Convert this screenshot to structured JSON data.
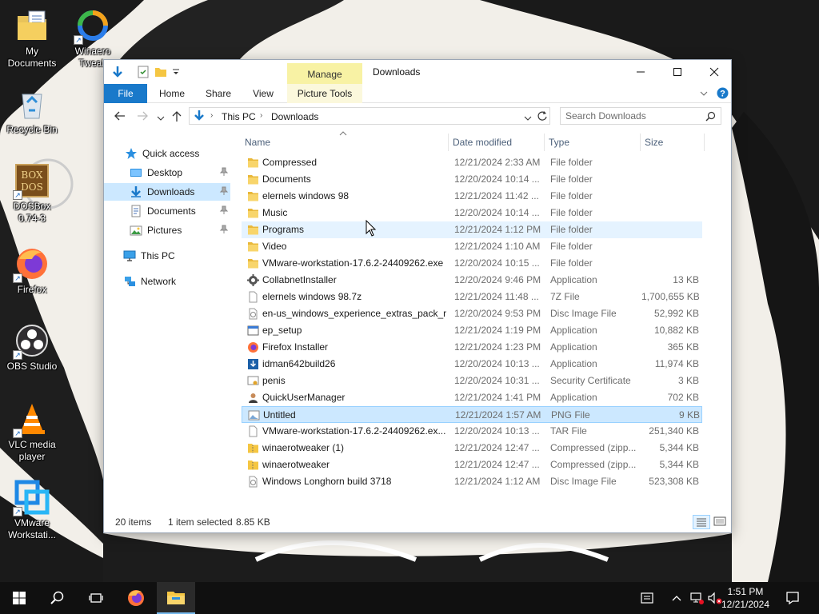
{
  "desktop": {
    "icons": [
      {
        "label": "My Documents",
        "icon": "my-documents-icon"
      },
      {
        "label": "Winaero Tweak",
        "icon": "winaero-tweaker-icon"
      },
      {
        "label": "Recycle Bin",
        "icon": "recycle-bin-icon"
      },
      {
        "label": "DOSBox 0.74-3",
        "icon": "dosbox-icon"
      },
      {
        "label": "Firefox",
        "icon": "firefox-icon"
      },
      {
        "label": "OBS Studio",
        "icon": "obs-icon"
      },
      {
        "label": "VLC media player",
        "icon": "vlc-icon"
      },
      {
        "label": "VMware Workstati...",
        "icon": "vmware-icon"
      }
    ]
  },
  "window": {
    "title": "Downloads",
    "manage_tab": "Manage",
    "ribbon_tabs": [
      "File",
      "Home",
      "Share",
      "View",
      "Picture Tools"
    ],
    "breadcrumb": [
      "This PC",
      "Downloads"
    ],
    "search_placeholder": "Search Downloads",
    "nav": [
      {
        "label": "Quick access",
        "icon": "star-icon",
        "pinned": false
      },
      {
        "label": "Desktop",
        "icon": "desktop-folder-icon",
        "pinned": true
      },
      {
        "label": "Downloads",
        "icon": "downloads-folder-icon",
        "pinned": true
      },
      {
        "label": "Documents",
        "icon": "documents-folder-icon",
        "pinned": true
      },
      {
        "label": "Pictures",
        "icon": "pictures-folder-icon",
        "pinned": true
      },
      {
        "label": "This PC",
        "icon": "computer-icon",
        "pinned": false
      },
      {
        "label": "Network",
        "icon": "network-icon",
        "pinned": false
      }
    ],
    "columns": [
      "Name",
      "Date modified",
      "Type",
      "Size"
    ],
    "files": [
      {
        "name": "Compressed",
        "date": "12/21/2024 2:33 AM",
        "type": "File folder",
        "size": "",
        "icon": "folder"
      },
      {
        "name": "Documents",
        "date": "12/20/2024 10:14 ...",
        "type": "File folder",
        "size": "",
        "icon": "folder"
      },
      {
        "name": "elernels windows 98",
        "date": "12/21/2024 11:42 ...",
        "type": "File folder",
        "size": "",
        "icon": "folder"
      },
      {
        "name": "Music",
        "date": "12/20/2024 10:14 ...",
        "type": "File folder",
        "size": "",
        "icon": "folder"
      },
      {
        "name": "Programs",
        "date": "12/21/2024 1:12 PM",
        "type": "File folder",
        "size": "",
        "icon": "folder"
      },
      {
        "name": "Video",
        "date": "12/21/2024 1:10 AM",
        "type": "File folder",
        "size": "",
        "icon": "folder"
      },
      {
        "name": "VMware-workstation-17.6.2-24409262.exe",
        "date": "12/20/2024 10:15 ...",
        "type": "File folder",
        "size": "",
        "icon": "folder"
      },
      {
        "name": "CollabnetInstaller",
        "date": "12/20/2024 9:46 PM",
        "type": "Application",
        "size": "13 KB",
        "icon": "gear"
      },
      {
        "name": "elernels windows 98.7z",
        "date": "12/21/2024 11:48 ...",
        "type": "7Z File",
        "size": "1,700,655 KB",
        "icon": "file"
      },
      {
        "name": "en-us_windows_experience_extras_pack_r...",
        "date": "12/20/2024 9:53 PM",
        "type": "Disc Image File",
        "size": "52,992 KB",
        "icon": "disc"
      },
      {
        "name": "ep_setup",
        "date": "12/21/2024 1:19 PM",
        "type": "Application",
        "size": "10,882 KB",
        "icon": "app"
      },
      {
        "name": "Firefox Installer",
        "date": "12/21/2024 1:23 PM",
        "type": "Application",
        "size": "365 KB",
        "icon": "firefox"
      },
      {
        "name": "idman642build26",
        "date": "12/20/2024 10:13 ...",
        "type": "Application",
        "size": "11,974 KB",
        "icon": "idm"
      },
      {
        "name": "penis",
        "date": "12/20/2024 10:31 ...",
        "type": "Security Certificate",
        "size": "3 KB",
        "icon": "cert"
      },
      {
        "name": "QuickUserManager",
        "date": "12/21/2024 1:41 PM",
        "type": "Application",
        "size": "702 KB",
        "icon": "user"
      },
      {
        "name": "Untitled",
        "date": "12/21/2024 1:57 AM",
        "type": "PNG File",
        "size": "9 KB",
        "icon": "image"
      },
      {
        "name": "VMware-workstation-17.6.2-24409262.ex...",
        "date": "12/20/2024 10:13 ...",
        "type": "TAR File",
        "size": "251,340 KB",
        "icon": "file"
      },
      {
        "name": "winaerotweaker (1)",
        "date": "12/21/2024 12:47 ...",
        "type": "Compressed (zipp...",
        "size": "5,344 KB",
        "icon": "zip"
      },
      {
        "name": "winaerotweaker",
        "date": "12/21/2024 12:47 ...",
        "type": "Compressed (zipp...",
        "size": "5,344 KB",
        "icon": "zip"
      },
      {
        "name": "Windows Longhorn build 3718",
        "date": "12/21/2024 1:12 AM",
        "type": "Disc Image File",
        "size": "523,308 KB",
        "icon": "disc"
      }
    ],
    "hovered_row": "Programs",
    "selected_row": "Untitled",
    "status": {
      "count": "20 items",
      "selection": "1 item selected",
      "size": "8.85 KB"
    }
  },
  "taskbar": {
    "time": "1:51 PM",
    "date": "12/21/2024",
    "apps": [
      "start-icon",
      "search-icon",
      "task-view-icon",
      "firefox-icon",
      "file-explorer-icon"
    ]
  },
  "colors": {
    "accent": "#1979ca",
    "manage_tab": "#f8f2a4",
    "selection": "#cce8ff",
    "hover": "#e5f3ff",
    "folder": "#f5c642",
    "taskbar": "#101010"
  }
}
